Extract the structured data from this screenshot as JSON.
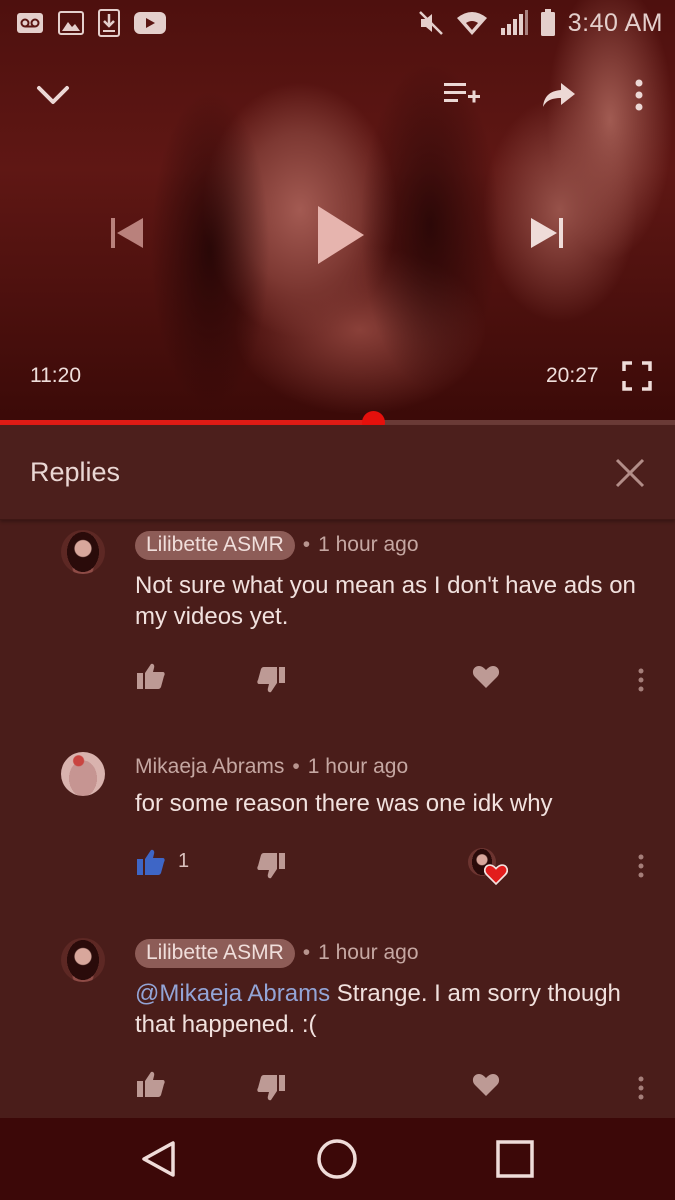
{
  "status_bar": {
    "time": "3:40 AM",
    "left_icons": [
      "voicemail-icon",
      "image-icon",
      "download-icon",
      "youtube-icon"
    ],
    "right_icons": [
      "mute-icon",
      "wifi-icon",
      "signal-icon",
      "battery-icon"
    ]
  },
  "player": {
    "current_time": "11:20",
    "duration": "20:27",
    "progress_fraction": 0.553,
    "controls": [
      "collapse-icon",
      "add-to-queue-icon",
      "share-icon",
      "more-icon",
      "previous-icon",
      "play-icon",
      "next-icon",
      "fullscreen-icon"
    ]
  },
  "replies": {
    "title": "Replies",
    "comments": [
      {
        "author": "Lilibette ASMR",
        "author_is_creator": true,
        "time": "1 hour ago",
        "text": "Not sure what you mean as I don't have ads on my videos yet.",
        "likes": ""
      },
      {
        "author": "Mikaeja Abrams",
        "author_is_creator": false,
        "time": "1 hour ago",
        "text": "for some reason there was one idk why",
        "likes": "1",
        "hearted": true
      },
      {
        "author": "Lilibette ASMR",
        "author_is_creator": true,
        "time": "1 hour ago",
        "mention": "@Mikaeja Abrams",
        "text": " Strange.  I am sorry though that happened.  :(",
        "likes": ""
      }
    ],
    "separator": "•"
  },
  "colors": {
    "progress": "#e01b15",
    "creator_chip": "#8d5c57",
    "mention": "#93a4d6",
    "liked_thumb": "#3e66c6",
    "heart": "#e21d1d"
  }
}
